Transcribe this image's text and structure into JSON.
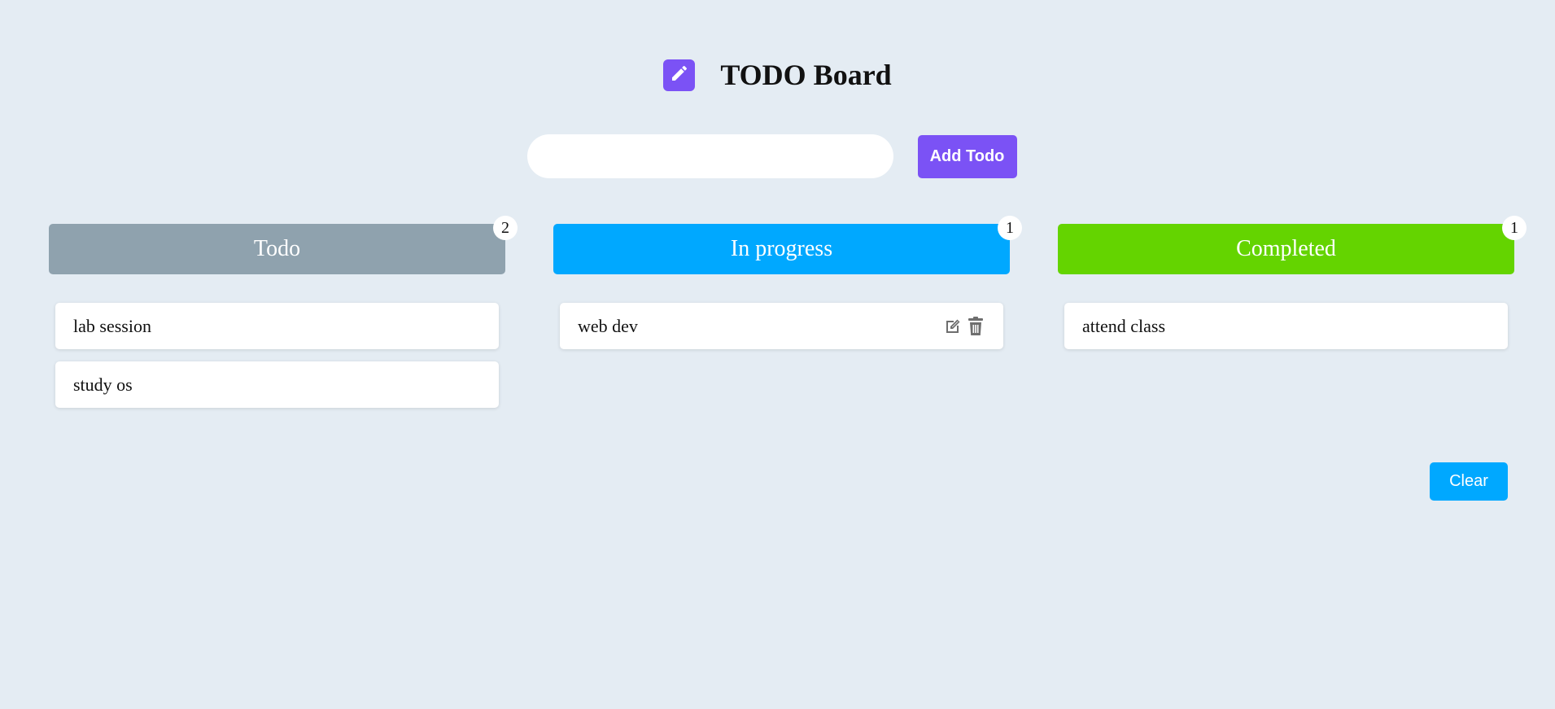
{
  "header": {
    "title": "TODO Board",
    "logo_icon": "pencil-icon",
    "logo_color": "#7b52f5"
  },
  "add_form": {
    "input_value": "",
    "input_placeholder": "",
    "button_label": "Add Todo",
    "button_color": "#7b52f5"
  },
  "columns": [
    {
      "title": "Todo",
      "count": "2",
      "color": "#8fa2ae",
      "cards": [
        {
          "text": "lab session"
        },
        {
          "text": "study os"
        }
      ]
    },
    {
      "title": "In progress",
      "count": "1",
      "color": "#00a8ff",
      "cards": [
        {
          "text": "web dev",
          "actions": [
            "edit-icon",
            "trash-icon"
          ]
        }
      ]
    },
    {
      "title": "Completed",
      "count": "1",
      "color": "#64d400",
      "cards": [
        {
          "text": "attend class"
        }
      ]
    }
  ],
  "clear_button": {
    "label": "Clear",
    "color": "#00a8ff"
  }
}
